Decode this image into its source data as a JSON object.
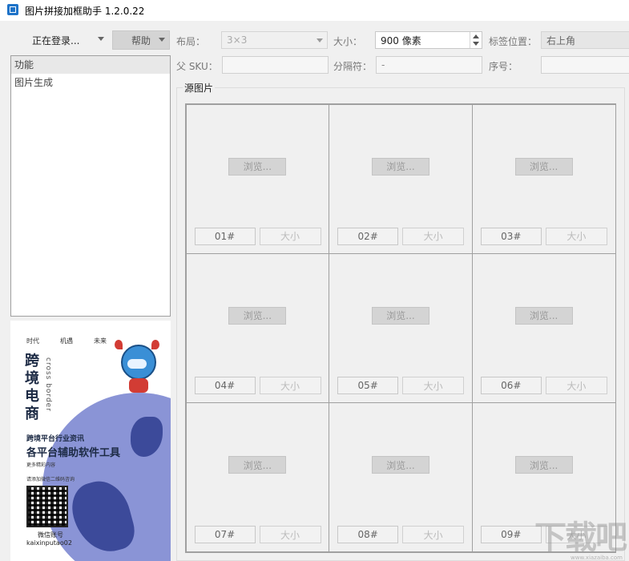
{
  "window": {
    "title": "图片拼接加框助手 1.2.0.22"
  },
  "toolbar": {
    "login_label": "正在登录...",
    "help_label": "帮助"
  },
  "settings": {
    "layout_label": "布局：",
    "layout_value": "3×3",
    "size_label": "大小：",
    "size_value": "900 像素",
    "tag_pos_label": "标签位置：",
    "tag_pos_value": "右上角",
    "sku_label": "父 SKU：",
    "sku_value": "",
    "separator_label": "分隔符：",
    "separator_value": "-",
    "index_label": "序号：",
    "index_value": ""
  },
  "sidebar": {
    "items": [
      {
        "label": "功能",
        "selected": true
      },
      {
        "label": "图片生成",
        "selected": false
      }
    ]
  },
  "ad": {
    "tags": [
      "时代",
      "机遇",
      "未来"
    ],
    "headline": "跨境电商",
    "headline_en": "cross border",
    "line1": "跨境平台行业资讯",
    "line2": "各平台辅助软件工具",
    "line3": "更多精彩内容",
    "line4": "请添加微信二维码咨询",
    "wechat_label": "微信账号",
    "wechat_id": "kaixinputao02"
  },
  "source": {
    "group_title": "源图片",
    "browse_label": "浏览...",
    "size_label": "大小",
    "cells": [
      {
        "num": "01#"
      },
      {
        "num": "02#"
      },
      {
        "num": "03#"
      },
      {
        "num": "04#"
      },
      {
        "num": "05#"
      },
      {
        "num": "06#"
      },
      {
        "num": "07#"
      },
      {
        "num": "08#"
      },
      {
        "num": "09#"
      }
    ]
  },
  "watermark": {
    "text": "下载吧",
    "url": "www.xiazaiba.com"
  }
}
